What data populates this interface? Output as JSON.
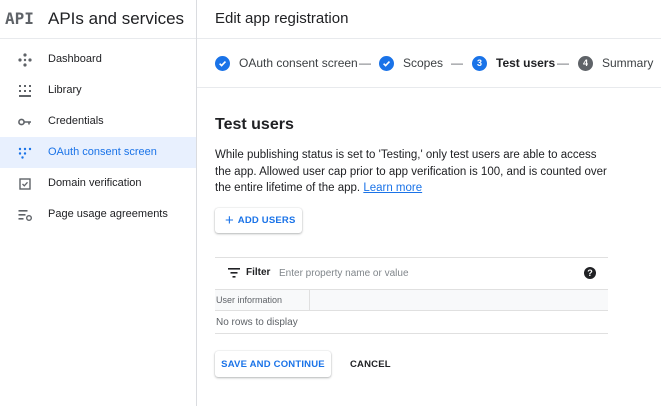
{
  "sidebar": {
    "logo": "API",
    "title": "APIs and services",
    "items": [
      {
        "label": "Dashboard",
        "icon": "dashboard-icon",
        "active": false
      },
      {
        "label": "Library",
        "icon": "library-icon",
        "active": false
      },
      {
        "label": "Credentials",
        "icon": "key-icon",
        "active": false
      },
      {
        "label": "OAuth consent screen",
        "icon": "oauth-icon",
        "active": true
      },
      {
        "label": "Domain verification",
        "icon": "checkbox-icon",
        "active": false
      },
      {
        "label": "Page usage agreements",
        "icon": "settings-list-icon",
        "active": false
      }
    ]
  },
  "header": {
    "title": "Edit app registration"
  },
  "stepper": {
    "steps": [
      {
        "label": "OAuth consent screen",
        "state": "done"
      },
      {
        "label": "Scopes",
        "state": "done"
      },
      {
        "number": "3",
        "label": "Test users",
        "state": "current"
      },
      {
        "number": "4",
        "label": "Summary",
        "state": "todo"
      }
    ],
    "separator": "—"
  },
  "main": {
    "section_title": "Test users",
    "description": "While publishing status is set to 'Testing,' only test users are able to access the app. Allowed user cap prior to app verification is 100, and is counted over the entire lifetime of the app.",
    "learn_more": "Learn more",
    "add_users_plus": "+",
    "add_users_label": "ADD USERS",
    "filter_label": "Filter",
    "filter_placeholder": "Enter property name or value",
    "help_glyph": "?",
    "table_header": "User information",
    "empty_text": "No rows to display",
    "save_label": "SAVE AND CONTINUE",
    "cancel_label": "CANCEL"
  },
  "colors": {
    "accent": "#1a73e8",
    "active_bg": "#e8f0fe",
    "text": "#202124",
    "muted": "#5f6368"
  }
}
